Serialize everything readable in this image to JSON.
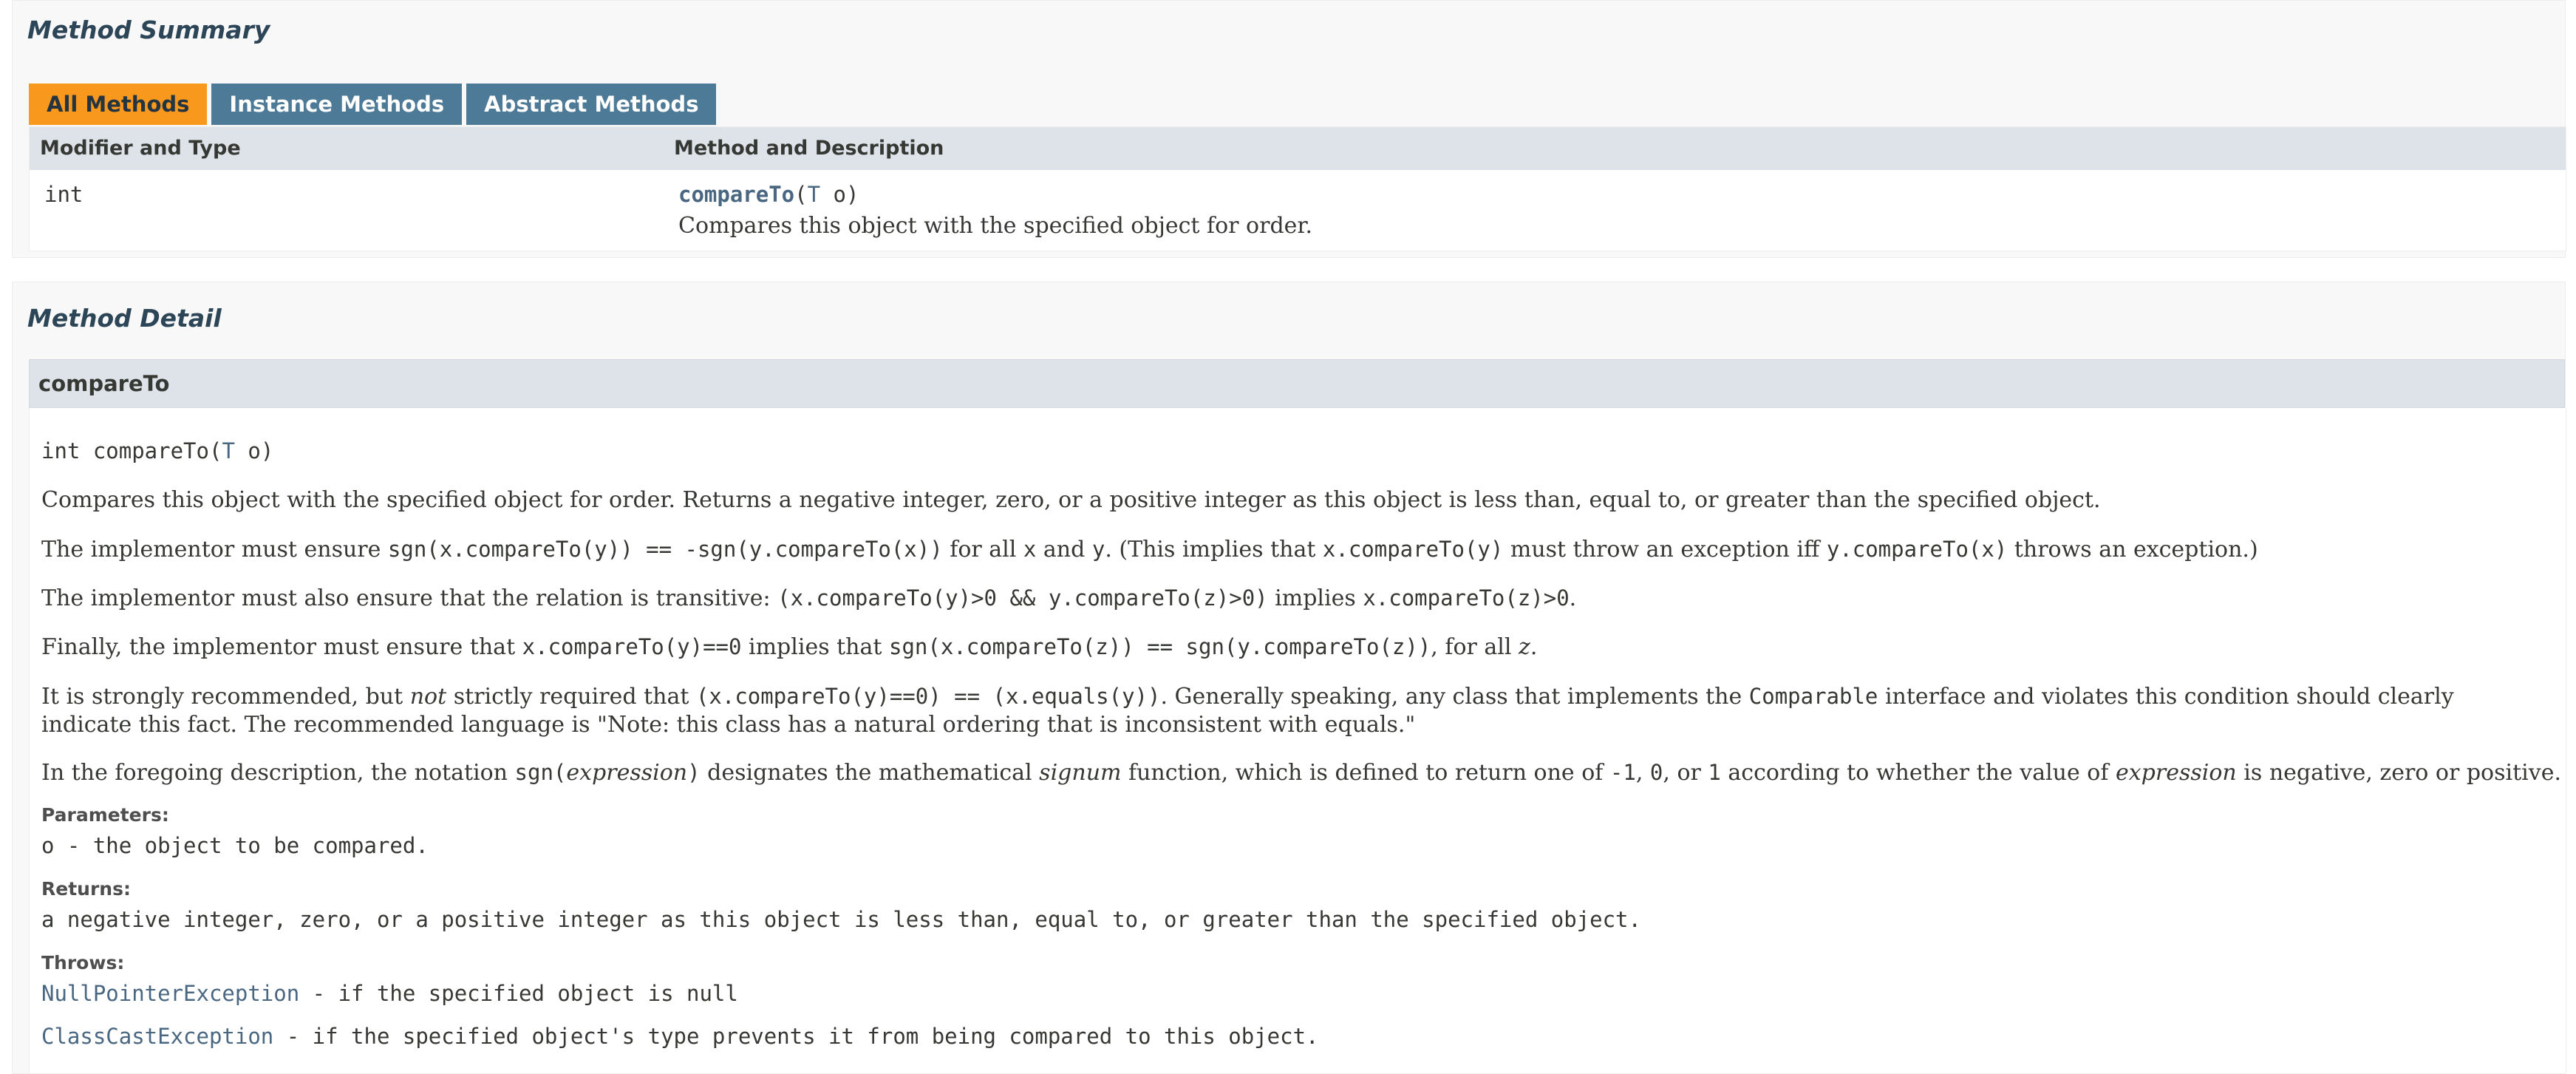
{
  "summary": {
    "title": "Method Summary",
    "tabs": [
      {
        "label": "All Methods",
        "active": true
      },
      {
        "label": "Instance Methods",
        "active": false
      },
      {
        "label": "Abstract Methods",
        "active": false
      }
    ],
    "columns": [
      "Modifier and Type",
      "Method and Description"
    ],
    "rows": [
      {
        "modifier": "int",
        "method_name": "compareTo",
        "param_open": "(",
        "param_type": "T",
        "param_rest": " o)",
        "description": "Compares this object with the specified object for order."
      }
    ]
  },
  "detail": {
    "title": "Method Detail",
    "method_header": "compareTo",
    "signature": {
      "prefix": "int compareTo(",
      "type": "T",
      "suffix": " o)"
    },
    "p1": "Compares this object with the specified object for order. Returns a negative integer, zero, or a positive integer as this object is less than, equal to, or greater than the specified object.",
    "p2": {
      "t1": "The implementor must ensure ",
      "c1": "sgn(x.compareTo(y)) == -sgn(y.compareTo(x))",
      "t2": " for all ",
      "c2": "x",
      "t3": " and ",
      "c3": "y",
      "t4": ". (This implies that ",
      "c4": "x.compareTo(y)",
      "t5": " must throw an exception iff ",
      "c5": "y.compareTo(x)",
      "t6": " throws an exception.)"
    },
    "p3": {
      "t1": "The implementor must also ensure that the relation is transitive: ",
      "c1": "(x.compareTo(y)>0 && y.compareTo(z)>0)",
      "t2": " implies ",
      "c2": "x.compareTo(z)>0",
      "t3": "."
    },
    "p4": {
      "t1": "Finally, the implementor must ensure that ",
      "c1": "x.compareTo(y)==0",
      "t2": " implies that ",
      "c2": "sgn(x.compareTo(z)) == sgn(y.compareTo(z))",
      "t3": ", for all ",
      "c3": "z",
      "t4": "."
    },
    "p5": {
      "t1": "It is strongly recommended, but ",
      "em1": "not",
      "t2": " strictly required that ",
      "c1": "(x.compareTo(y)==0) == (x.equals(y))",
      "t3": ". Generally speaking, any class that implements the ",
      "c2": "Comparable",
      "t4": " interface and violates this condition should clearly indicate this fact. The recommended language is \"Note: this class has a natural ordering that is inconsistent with equals.\""
    },
    "p6": {
      "t1": "In the foregoing description, the notation ",
      "c1": "sgn(",
      "em1": "expression",
      "c2": ")",
      "t2": " designates the mathematical ",
      "em2": "signum",
      "t3": " function, which is defined to return one of ",
      "c3": "-1",
      "t4": ", ",
      "c4": "0",
      "t5": ", or ",
      "c5": "1",
      "t6": " according to whether the value of ",
      "em3": "expression",
      "t7": " is negative, zero or positive."
    },
    "params_label": "Parameters:",
    "param_text": "o - the object to be compared.",
    "returns_label": "Returns:",
    "returns_text": "a negative integer, zero, or a positive integer as this object is less than, equal to, or greater than the specified object.",
    "throws_label": "Throws:",
    "throws": [
      {
        "exception": "NullPointerException",
        "text": " - if the specified object is null"
      },
      {
        "exception": "ClassCastException",
        "text": " - if the specified object's type prevents it from being compared to this object."
      }
    ]
  }
}
